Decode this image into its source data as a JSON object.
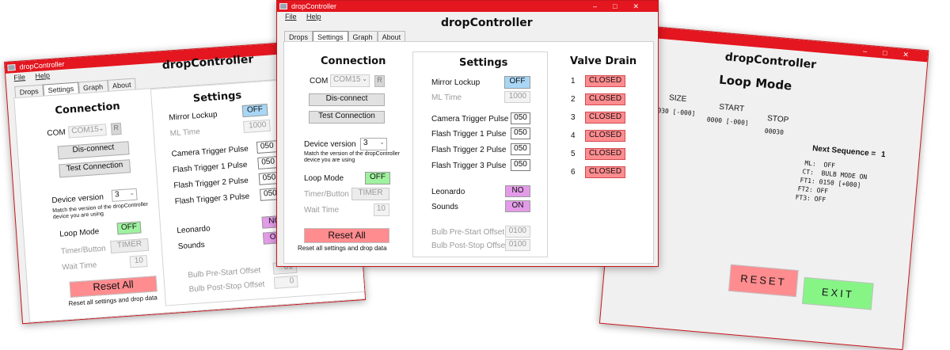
{
  "app": {
    "window_title": "dropController",
    "header_title": "dropController",
    "window_controls": [
      "–",
      "□",
      "✕"
    ]
  },
  "menu": {
    "file": "File",
    "help": "Help"
  },
  "tabs": {
    "drops": "Drops",
    "settings": "Settings",
    "graph": "Graph",
    "about": "About"
  },
  "connection": {
    "title": "Connection",
    "com_label": "COM",
    "com_value": "COM15",
    "refresh_label": "R",
    "disconnect": "Dis-connect",
    "test": "Test Connection",
    "device_label": "Device version",
    "device_value": "3",
    "device_note_1": "Match the version of the dropController",
    "device_note_2": "device you are using",
    "loop_mode_label": "Loop Mode",
    "loop_mode_value": "OFF",
    "timer_label": "Timer/Button",
    "timer_value": "TIMER",
    "wait_label": "Wait Time",
    "wait_value": "10",
    "reset_all": "Reset All",
    "reset_note": "Reset all settings and drop data"
  },
  "settings": {
    "title": "Settings",
    "mirror_label": "Mirror Lockup",
    "mirror_value": "OFF",
    "ml_time_label": "ML Time",
    "ml_time_value": "1000",
    "camera_label": "Camera Trigger Pulse",
    "camera_value": "050",
    "flash1_label": "Flash Trigger 1 Pulse",
    "flash1_value": "050",
    "flash2_label": "Flash Trigger 2 Pulse",
    "flash2_value": "050",
    "flash3_label": "Flash Trigger 3 Pulse",
    "flash3_value": "050",
    "leonardo_label": "Leonardo",
    "leonardo_value": "NO",
    "sounds_label": "Sounds",
    "sounds_value": "ON",
    "bulb_pre_label": "Bulb Pre-Start Offset",
    "bulb_pre_value": "0100",
    "bulb_post_label": "Bulb Post-Stop Offset",
    "bulb_post_value": "0100",
    "left_leonardo_partial": "NO",
    "left_sounds_partial": "ON",
    "left_pre_partial": "01",
    "left_post_partial": "0"
  },
  "valve_drain": {
    "title": "Valve Drain",
    "valves": [
      {
        "num": "1",
        "state": "CLOSED"
      },
      {
        "num": "2",
        "state": "CLOSED"
      },
      {
        "num": "3",
        "state": "CLOSED"
      },
      {
        "num": "4",
        "state": "CLOSED"
      },
      {
        "num": "5",
        "state": "CLOSED"
      },
      {
        "num": "6",
        "state": "CLOSED"
      }
    ]
  },
  "loop_mode": {
    "title": "Loop Mode",
    "col_size": "SIZE",
    "col_start": "START",
    "col_stop": "STOP",
    "size_value": "0030 [-000]",
    "start_value": "0000 [-000]",
    "stop_value": "00030",
    "next_seq_label": "Next Sequence =",
    "next_seq_value": "1",
    "ml_line": "ML:  OFF",
    "ct_line": "CT:  BULB MODE ON",
    "ft1_line": "FT1: 0150 [+000]",
    "ft2_line": "FT2: OFF",
    "ft3_line": "FT3: OFF",
    "reset": "RESET",
    "exit": "EXIT"
  },
  "colors": {
    "titlebar": "#e4161f",
    "toggle_blue": "#a9d6f5",
    "toggle_green": "#9ff29f",
    "toggle_purple": "#e39be8",
    "closed_red": "#ff8c8f",
    "exit_green": "#86f586"
  }
}
